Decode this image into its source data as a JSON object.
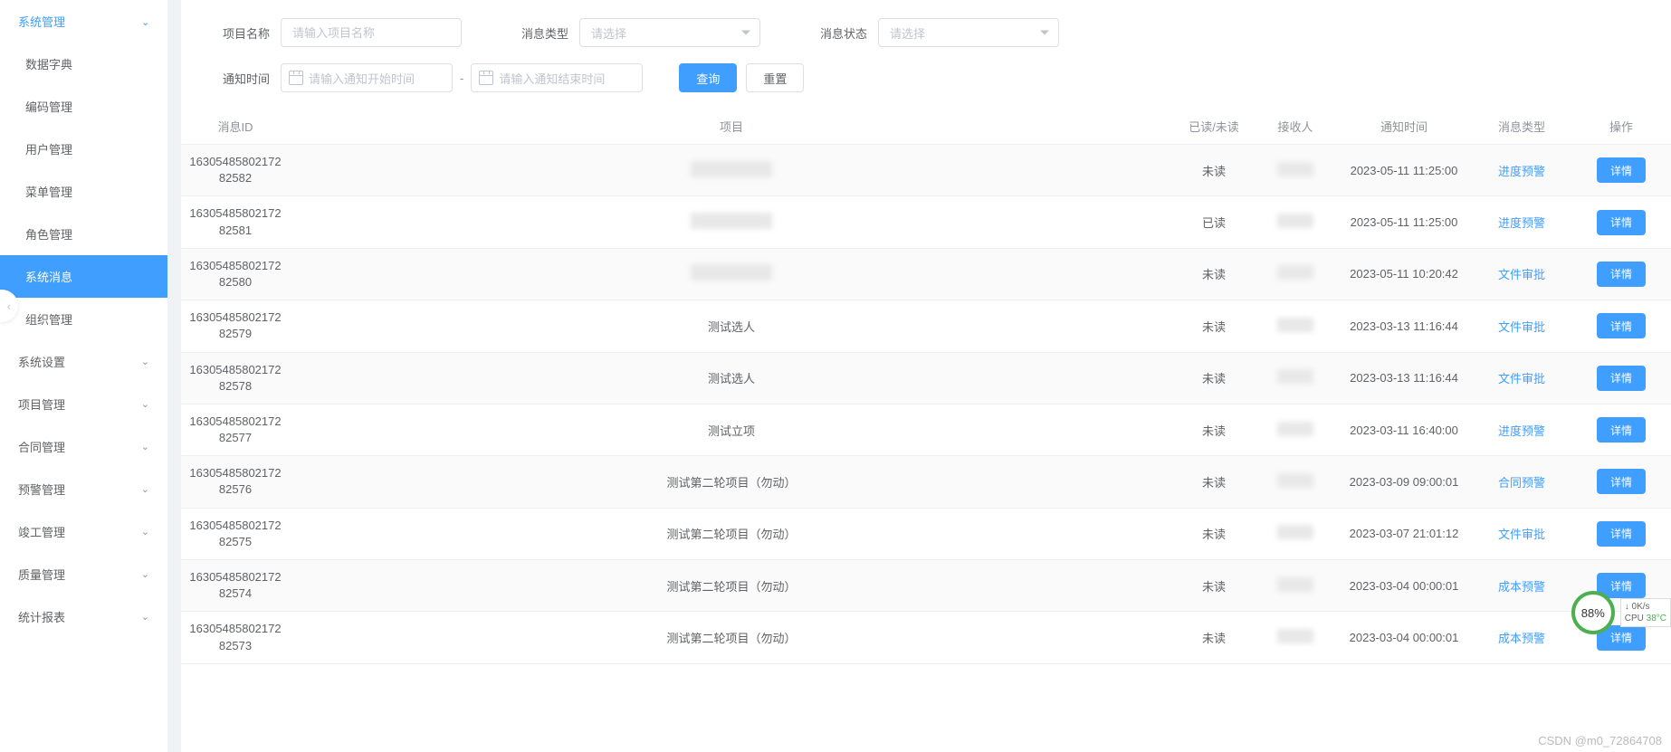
{
  "sidebar": {
    "top": {
      "label": "系统管理",
      "expanded": true
    },
    "subs": [
      {
        "label": "数据字典"
      },
      {
        "label": "编码管理"
      },
      {
        "label": "用户管理"
      },
      {
        "label": "菜单管理"
      },
      {
        "label": "角色管理"
      },
      {
        "label": "系统消息",
        "active": true
      },
      {
        "label": "组织管理"
      }
    ],
    "groups": [
      {
        "label": "系统设置"
      },
      {
        "label": "项目管理"
      },
      {
        "label": "合同管理"
      },
      {
        "label": "预警管理"
      },
      {
        "label": "竣工管理"
      },
      {
        "label": "质量管理"
      },
      {
        "label": "统计报表"
      }
    ]
  },
  "search": {
    "project_label": "项目名称",
    "project_placeholder": "请输入项目名称",
    "type_label": "消息类型",
    "type_placeholder": "请选择",
    "status_label": "消息状态",
    "status_placeholder": "请选择",
    "time_label": "通知时间",
    "start_placeholder": "请输入通知开始时间",
    "end_placeholder": "请输入通知结束时间",
    "sep": "-",
    "query_btn": "查询",
    "reset_btn": "重置"
  },
  "table": {
    "headers": {
      "id": "消息ID",
      "project": "项目",
      "read": "已读/未读",
      "receiver": "接收人",
      "time": "通知时间",
      "type": "消息类型",
      "op": "操作"
    },
    "detail_btn": "详情",
    "rows": [
      {
        "id": "1630548580217282582",
        "project": "",
        "project_hidden": true,
        "read": "未读",
        "receiver_hidden": true,
        "time": "2023-05-11 11:25:00",
        "type": "进度预警"
      },
      {
        "id": "1630548580217282581",
        "project": "",
        "project_hidden": true,
        "read": "已读",
        "receiver_hidden": true,
        "time": "2023-05-11 11:25:00",
        "type": "进度预警"
      },
      {
        "id": "1630548580217282580",
        "project": "",
        "project_hidden": true,
        "read": "未读",
        "receiver_hidden": true,
        "time": "2023-05-11 10:20:42",
        "type": "文件审批"
      },
      {
        "id": "1630548580217282579",
        "project": "测试选人",
        "project_hidden": false,
        "read": "未读",
        "receiver_hidden": true,
        "time": "2023-03-13 11:16:44",
        "type": "文件审批"
      },
      {
        "id": "1630548580217282578",
        "project": "测试选人",
        "project_hidden": false,
        "read": "未读",
        "receiver_hidden": true,
        "time": "2023-03-13 11:16:44",
        "type": "文件审批"
      },
      {
        "id": "1630548580217282577",
        "project": "测试立项",
        "project_hidden": false,
        "read": "未读",
        "receiver_hidden": true,
        "time": "2023-03-11 16:40:00",
        "type": "进度预警"
      },
      {
        "id": "1630548580217282576",
        "project": "测试第二轮项目（勿动）",
        "project_hidden": false,
        "read": "未读",
        "receiver_hidden": true,
        "time": "2023-03-09 09:00:01",
        "type": "合同预警"
      },
      {
        "id": "1630548580217282575",
        "project": "测试第二轮项目（勿动）",
        "project_hidden": false,
        "read": "未读",
        "receiver_hidden": true,
        "time": "2023-03-07 21:01:12",
        "type": "文件审批"
      },
      {
        "id": "1630548580217282574",
        "project": "测试第二轮项目（勿动）",
        "project_hidden": false,
        "read": "未读",
        "receiver_hidden": true,
        "time": "2023-03-04 00:00:01",
        "type": "成本预警"
      },
      {
        "id": "1630548580217282573",
        "project": "测试第二轮项目（勿动）",
        "project_hidden": false,
        "read": "未读",
        "receiver_hidden": true,
        "time": "2023-03-04 00:00:01",
        "type": "成本预警"
      }
    ]
  },
  "cpu": {
    "percent": "88%",
    "net": "0K/s",
    "cpu_label": "CPU",
    "temp": "38°C"
  },
  "watermark": "CSDN @m0_72864708"
}
